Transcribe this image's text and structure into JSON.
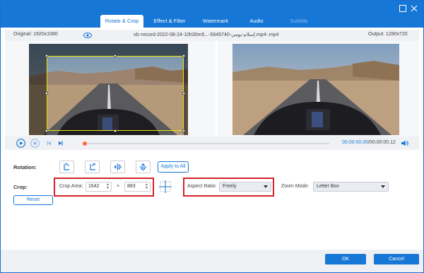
{
  "tabs": [
    {
      "label": "Rotate & Crop",
      "state": "active"
    },
    {
      "label": "Effect & Filter",
      "state": "normal"
    },
    {
      "label": "Watermark",
      "state": "normal"
    },
    {
      "label": "Audio",
      "state": "normal"
    },
    {
      "label": "Subtitle",
      "state": "disabled"
    }
  ],
  "window": {
    "minimize_icon": "minimize-icon",
    "close_icon": "close-icon"
  },
  "info": {
    "original": "Original: 1920x1080",
    "filename": "vlc-record-2022-08-24-10h30m5...-5645740-إسلام-يومي.mp4-.mp4",
    "output": "Output: 1280x720"
  },
  "player": {
    "progress": 0.0,
    "time_current": "00:00:00.00",
    "time_total": "/00:00:00.12"
  },
  "rotation": {
    "label": "Rotation:",
    "apply_all": "Apply to All"
  },
  "crop": {
    "label": "Crop:",
    "area_label": "Crop Area:",
    "width": "1642",
    "times": "×",
    "height": "883",
    "aspect_label": "Aspect Ratio:",
    "aspect_value": "Freely",
    "zoom_label": "Zoom Mode:",
    "zoom_value": "Letter Box",
    "reset": "Reset"
  },
  "footer": {
    "ok": "OK",
    "cancel": "Cancel"
  },
  "colors": {
    "accent": "#1677d6",
    "highlight": "#d4232a",
    "crop_frame": "#e8e800",
    "playhead": "#ff6a3d"
  }
}
